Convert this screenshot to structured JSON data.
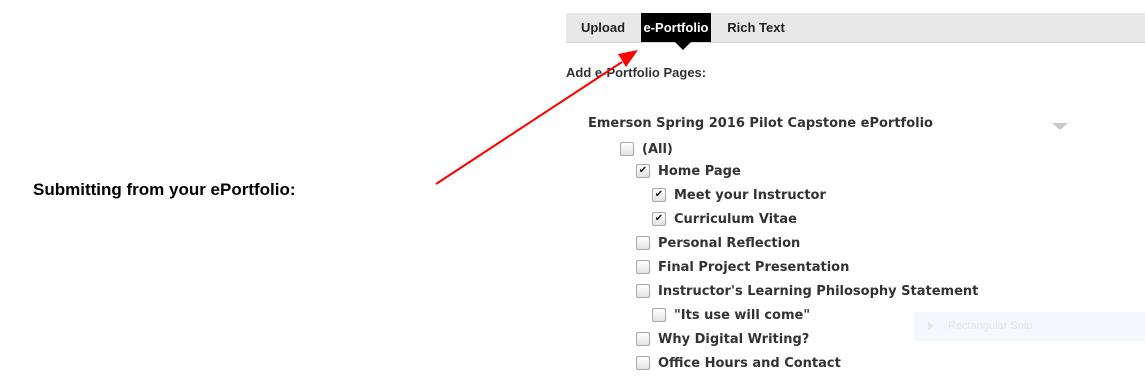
{
  "tabs": [
    {
      "label": "Upload",
      "active": false
    },
    {
      "label": "e-Portfolio",
      "active": true
    },
    {
      "label": "Rich Text",
      "active": false
    }
  ],
  "section_heading": "Add e-Portfolio Pages:",
  "portfolio": {
    "title": "Emerson Spring 2016 Pilot Capstone ePortfolio"
  },
  "tree": [
    {
      "label": "(All)",
      "checked": false,
      "level": 0
    },
    {
      "label": "Home Page",
      "checked": true,
      "level": 1
    },
    {
      "label": "Meet your Instructor",
      "checked": true,
      "level": 2
    },
    {
      "label": "Curriculum Vitae",
      "checked": true,
      "level": 2
    },
    {
      "label": "Personal Reflection",
      "checked": false,
      "level": 1
    },
    {
      "label": "Final Project Presentation",
      "checked": false,
      "level": 1
    },
    {
      "label": "Instructor's Learning Philosophy Statement",
      "checked": false,
      "level": 1
    },
    {
      "label": "\"Its use will come\"",
      "checked": false,
      "level": 2
    },
    {
      "label": "Why Digital Writing?",
      "checked": false,
      "level": 1
    },
    {
      "label": "Office Hours and Contact",
      "checked": false,
      "level": 1
    }
  ],
  "annotation": {
    "label": "Submitting from your ePortfolio:",
    "arrow_color": "#ff0000"
  },
  "ghost_overlay": {
    "label": "Rectangular Snip"
  },
  "colors": {
    "active_tab_bg": "#000000",
    "tabbar_bg": "#e8e8e8",
    "text": "#333333"
  }
}
